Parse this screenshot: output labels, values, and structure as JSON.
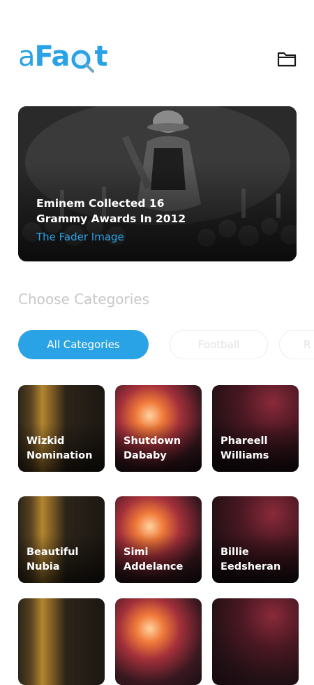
{
  "header": {
    "logo": {
      "a": "a",
      "fa": "Fa",
      "c": "c",
      "t": "t"
    },
    "icon": "folder-icon"
  },
  "hero": {
    "title": "Eminem Collected 16 Grammy Awards In 2012",
    "source": "The Fader Image"
  },
  "categories": {
    "title": "Choose Categories",
    "chips": [
      {
        "label": "All Categories",
        "active": true
      },
      {
        "label": "Football",
        "active": false
      },
      {
        "label": "R",
        "active": false
      }
    ]
  },
  "tiles": [
    {
      "label": "Wizkid Nomination",
      "style": "gold"
    },
    {
      "label": "Shutdown Dababy",
      "style": "fire"
    },
    {
      "label": "Phareell Williams",
      "style": "crimson"
    },
    {
      "label": "Beautiful Nubia",
      "style": "gold"
    },
    {
      "label": "Simi Addelance",
      "style": "fire"
    },
    {
      "label": "Billie Eedsheran",
      "style": "crimson"
    },
    {
      "label": "",
      "style": "gold"
    },
    {
      "label": "",
      "style": "fire"
    },
    {
      "label": "",
      "style": "crimson"
    }
  ],
  "colors": {
    "accent": "#2aa3e6",
    "muted": "#c8c8c8"
  }
}
